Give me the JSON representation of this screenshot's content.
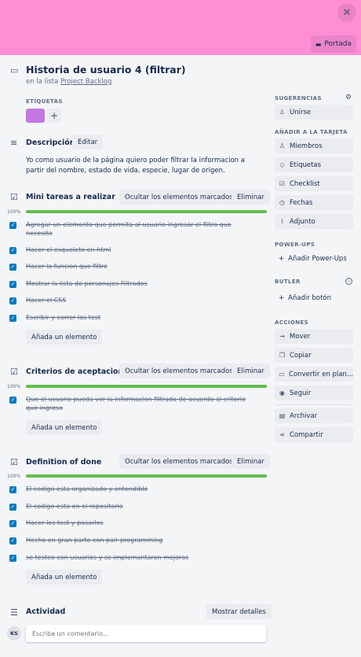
{
  "cover": {
    "color": "#ff8ed4",
    "button_label": "Portada"
  },
  "card": {
    "title": "Historia de usuario 4 (filtrar)",
    "in_list_prefix": "en la lista",
    "list_name": "Project Backlog"
  },
  "labels": {
    "heading": "ETIQUETAS",
    "chip_color": "#c377e0",
    "add": "+"
  },
  "description": {
    "heading": "Descripción",
    "edit_label": "Editar",
    "text": "Yo como usuario de la página quiero poder filtrar la informacion a partir del nombre, estado de vida, especie, lugar de origen."
  },
  "checklists": [
    {
      "title": "Mini tareas a realizar",
      "hide_label": "Ocultar los elementos marcados",
      "delete_label": "Eliminar",
      "progress": "100%",
      "items": [
        "Agregar un elemento que permita al usuario ingresar el filtro que necesita",
        "Hacer el esqueleto en html",
        "Hacer la funcion que filtre",
        "Mostrar la lista de personajes Filtrados",
        "Hacer el CSS",
        "Escribir y correr los test"
      ],
      "add_label": "Añada un elemento"
    },
    {
      "title": "Criterios de aceptacion",
      "hide_label": "Ocultar los elementos marcados",
      "delete_label": "Eliminar",
      "progress": "100%",
      "items": [
        "Que el usuario pueda ver la informacion filtrada de acuerdo al criterio que ingreso"
      ],
      "add_label": "Añada un elemento"
    },
    {
      "title": "Definition of done",
      "hide_label": "Ocultar los elementos marcados",
      "delete_label": "Eliminar",
      "progress": "100%",
      "items": [
        "El codigo esta organizado y entendible",
        "El codigo esta en el repositorio",
        "Hacer los test y pasarlos",
        "Hecho en gran parte con pair programming",
        "se testeo con usuarios y se implemantaron mejoras"
      ],
      "add_label": "Añada un elemento"
    }
  ],
  "activity": {
    "heading": "Actividad",
    "show_details": "Mostrar detalles",
    "avatar_initials": "KS",
    "comment_placeholder": "Escriba un comentario..."
  },
  "sidebar": {
    "suggestions_heading": "SUGERENCIAS",
    "join": "Unirse",
    "add_heading": "AÑADIR A LA TARJETA",
    "members": "Miembros",
    "labels": "Etiquetas",
    "checklist": "Checklist",
    "dates": "Fechas",
    "attachment": "Adjunto",
    "powerups_heading": "POWER-UPS",
    "add_powerups": "Añadir Power-Ups",
    "butler_heading": "BUTLER",
    "add_button": "Añadir botón",
    "actions_heading": "ACCIONES",
    "move": "Mover",
    "copy": "Copiar",
    "convert": "Convertir en plan...",
    "follow": "Seguir",
    "archive": "Archivar",
    "share": "Compartir"
  },
  "colors": {
    "progress": "#61bd4f",
    "checkbox": "#0079bf"
  }
}
